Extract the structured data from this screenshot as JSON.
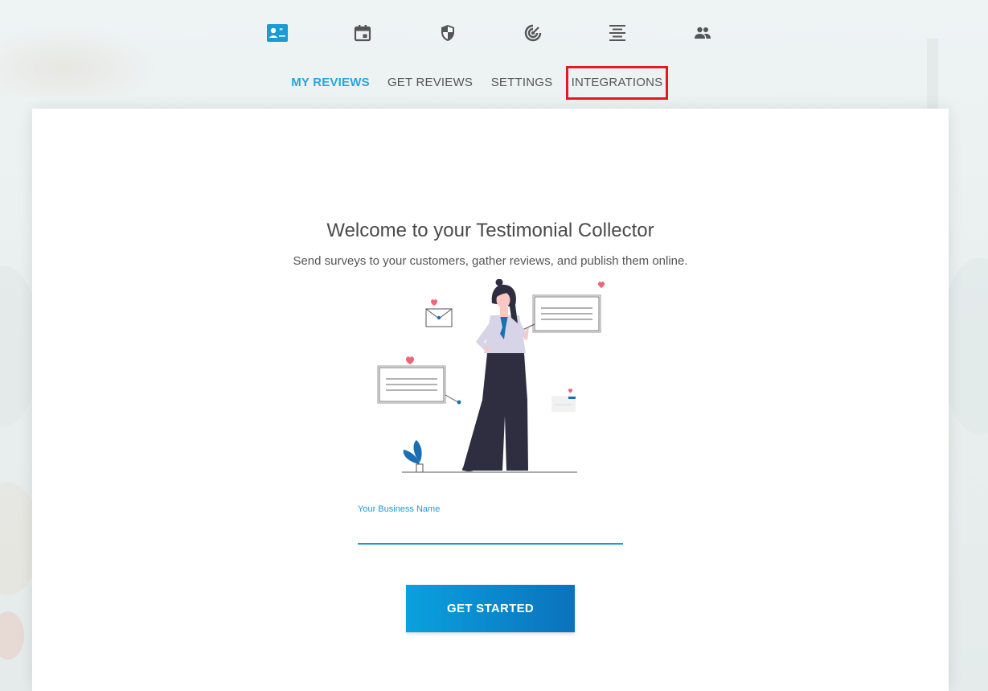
{
  "icon_nav": [
    {
      "icon": "testimonial-card-icon",
      "active": true
    },
    {
      "icon": "calendar-icon",
      "active": false
    },
    {
      "icon": "shield-icon",
      "active": false
    },
    {
      "icon": "radar-icon",
      "active": false
    },
    {
      "icon": "align-center-icon",
      "active": false
    },
    {
      "icon": "people-icon",
      "active": false
    }
  ],
  "tabs": [
    {
      "label": "MY REVIEWS",
      "active": true
    },
    {
      "label": "GET REVIEWS",
      "active": false
    },
    {
      "label": "SETTINGS",
      "active": false
    },
    {
      "label": "INTEGRATIONS",
      "active": false,
      "highlighted": true
    }
  ],
  "main": {
    "title": "Welcome to your Testimonial Collector",
    "subtitle": "Send surveys to your customers, gather reviews, and publish them online.",
    "business_field": {
      "label": "Your Business Name",
      "value": "",
      "placeholder": ""
    },
    "cta_label": "GET STARTED"
  },
  "colors": {
    "accent": "#2aa5dc",
    "icon_active": "#1a9ad6",
    "icon_inactive": "#555555",
    "highlight_border": "#e01b24",
    "button_gradient_start": "#0aa1dd",
    "button_gradient_end": "#0b72bd"
  }
}
